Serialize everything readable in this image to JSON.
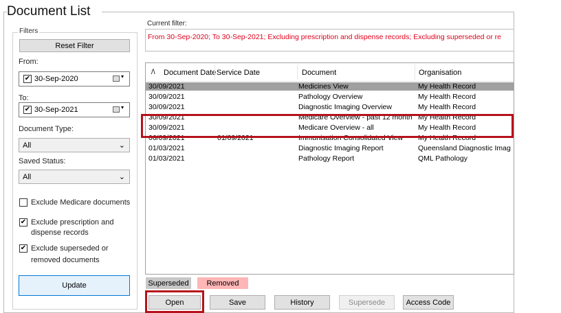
{
  "window": {
    "title": "Document List"
  },
  "filters": {
    "group_label": "Filters",
    "reset_label": "Reset Filter",
    "from_label": "From:",
    "from_value": "30-Sep-2020",
    "to_label": "To:",
    "to_value": "30-Sep-2021",
    "doc_type_label": "Document Type:",
    "doc_type_value": "All",
    "saved_status_label": "Saved Status:",
    "saved_status_value": "All",
    "exclude_medicare_label": "Exclude Medicare documents",
    "exclude_medicare_checked": false,
    "exclude_prescription_label_1": "Exclude prescription and",
    "exclude_prescription_label_2": "dispense records",
    "exclude_prescription_checked": true,
    "exclude_superseded_label_1": "Exclude superseded or",
    "exclude_superseded_label_2": "removed documents",
    "exclude_superseded_checked": true,
    "update_label": "Update"
  },
  "current_filter": {
    "label": "Current filter:",
    "text": "From 30-Sep-2020; To 30-Sep-2021; Excluding prescription and dispense records; Excluding superseded or re"
  },
  "table": {
    "sort_indicator": "/\\",
    "columns": [
      "Document Date",
      "Service Date",
      "Document",
      "Organisation"
    ],
    "rows": [
      {
        "document_date": "30/09/2021",
        "service_date": "",
        "document": "Medicines View",
        "organisation": "My Health Record",
        "selected": true
      },
      {
        "document_date": "30/09/2021",
        "service_date": "",
        "document": "Pathology Overview",
        "organisation": "My Health Record",
        "selected": false
      },
      {
        "document_date": "30/09/2021",
        "service_date": "",
        "document": "Diagnostic Imaging Overview",
        "organisation": "My Health Record",
        "selected": false
      },
      {
        "document_date": "30/09/2021",
        "service_date": "",
        "document": "Medicare Overview - past 12 month",
        "organisation": "My Health Record",
        "selected": false
      },
      {
        "document_date": "30/09/2021",
        "service_date": "",
        "document": "Medicare Overview - all",
        "organisation": "My Health Record",
        "selected": false
      },
      {
        "document_date": "06/09/2021",
        "service_date": "01/09/2021",
        "document": "Immunisation Consolidated View",
        "organisation": "My Health Record",
        "selected": false
      },
      {
        "document_date": "01/03/2021",
        "service_date": "",
        "document": "Diagnostic Imaging Report",
        "organisation": "Queensland Diagnostic Imag",
        "selected": false
      },
      {
        "document_date": "01/03/2021",
        "service_date": "",
        "document": "Pathology Report",
        "organisation": "QML Pathology",
        "selected": false
      }
    ]
  },
  "legend": {
    "superseded": "Superseded",
    "removed": "Removed"
  },
  "actions": {
    "open": "Open",
    "save": "Save",
    "history": "History",
    "supersede": "Supersede",
    "access_code": "Access Code"
  },
  "colors": {
    "selected_row": "#a0a0a0",
    "superseded": "#c8c8c8",
    "removed": "#ffb6b6",
    "highlight": "#b5121b",
    "filter_text": "#e0001b"
  }
}
